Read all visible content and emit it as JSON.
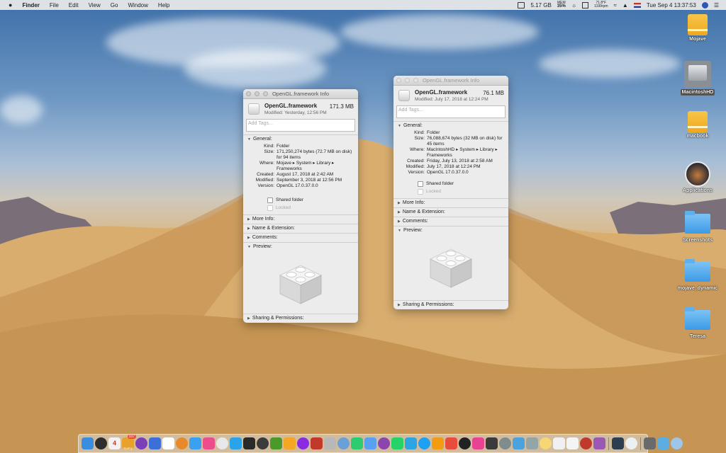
{
  "menubar": {
    "apple_icon": "apple-icon",
    "app_name": "Finder",
    "menus": [
      "File",
      "Edit",
      "View",
      "Go",
      "Window",
      "Help"
    ],
    "memory": "5.17 GB",
    "mem_label": "MEM",
    "mem_percent": "35%",
    "temp_line1": "71.8°F",
    "temp_line2": "1199rpm",
    "clock": "Tue Sep 4  13:37:53"
  },
  "desktop_icons": [
    {
      "label": "Mojave",
      "kind": "drive"
    },
    {
      "label": "MacintoshHD",
      "kind": "hdd"
    },
    {
      "label": "macbook",
      "kind": "drive"
    },
    {
      "label": "Applications",
      "kind": "app"
    },
    {
      "label": "Screenshots",
      "kind": "folder"
    },
    {
      "label": "mojave_dynamic",
      "kind": "folder"
    },
    {
      "label": "Teresa",
      "kind": "folder"
    }
  ],
  "window_left": {
    "title": "OpenGL.framework Info",
    "name": "OpenGL.framework",
    "size_short": "171.3 MB",
    "modified_header": "Modified: Yesterday, 12:56 PM",
    "tags_placeholder": "Add Tags...",
    "general_label": "General:",
    "kind_key": "Kind:",
    "kind_val": "Folder",
    "size_key": "Size:",
    "size_val": "171,250,274 bytes (72.7 MB on disk) for 94 items",
    "where_key": "Where:",
    "where_val": "Mojave ▸ System ▸ Library ▸ Frameworks",
    "created_key": "Created:",
    "created_val": "August 17, 2018 at 2:42 AM",
    "modified_key": "Modified:",
    "modified_val": "September 3, 2018 at 12:56 PM",
    "version_key": "Version:",
    "version_val": "OpenGL 17.0.37.0.0",
    "shared_folder": "Shared folder",
    "locked": "Locked",
    "more_info": "More Info:",
    "name_ext": "Name & Extension:",
    "comments": "Comments:",
    "preview": "Preview:",
    "sharing": "Sharing & Permissions:"
  },
  "window_right": {
    "title": "OpenGL.framework Info",
    "name": "OpenGL.framework",
    "size_short": "76.1 MB",
    "modified_header": "Modified: July 17, 2018 at 12:24 PM",
    "tags_placeholder": "Add Tags...",
    "general_label": "General:",
    "kind_key": "Kind:",
    "kind_val": "Folder",
    "size_key": "Size:",
    "size_val": "76,088,674 bytes (32 MB on disk) for 45 items",
    "where_key": "Where:",
    "where_val": "MacIntoshHD ▸ System ▸ Library ▸ Frameworks",
    "created_key": "Created:",
    "created_val": "Friday, July 13, 2018 at 2:58 AM",
    "modified_key": "Modified:",
    "modified_val": "July 17, 2018 at 12:24 PM",
    "version_key": "Version:",
    "version_val": "OpenGL 17.0.37.0.0",
    "shared_folder": "Shared folder",
    "locked": "Locked",
    "more_info": "More Info:",
    "name_ext": "Name & Extension:",
    "comments": "Comments:",
    "preview": "Preview:",
    "sharing": "Sharing & Permissions:"
  },
  "dock": {
    "calendar_day": "4",
    "badge": "337",
    "sunny_label": "Sunny",
    "colors": [
      "#3b8de0",
      "#2e2e2e",
      "#f2f2f2",
      "#e8a22c",
      "#7b3fb8",
      "#3d6fd8",
      "#ffffff",
      "#e88a2a",
      "#3aa0f0",
      "#ee4d8b",
      "#e8e8e8",
      "#2aa3e8",
      "#2a2a2a",
      "#3b3b3b",
      "#4a9a2a",
      "#f5a623",
      "#8a2be2",
      "#c0392b",
      "#b8b8b8",
      "#6aa0d8",
      "#2ecc71",
      "#5aa0f0",
      "#8e44ad",
      "#25d366",
      "#2ca5e0",
      "#1da1f2",
      "#f39c12",
      "#e74c3c",
      "#222222",
      "#e84393",
      "#3b3b3b",
      "#7f8c8d",
      "#4aa3df",
      "#95a5a6",
      "#f7d774",
      "#f0f0f0",
      "#f4f4f4",
      "#c0392b",
      "#9b59b6",
      "#2c3e50",
      "#ecf0f1",
      "#6a6a6a",
      "#5dade2",
      "#9ec6e8"
    ]
  }
}
